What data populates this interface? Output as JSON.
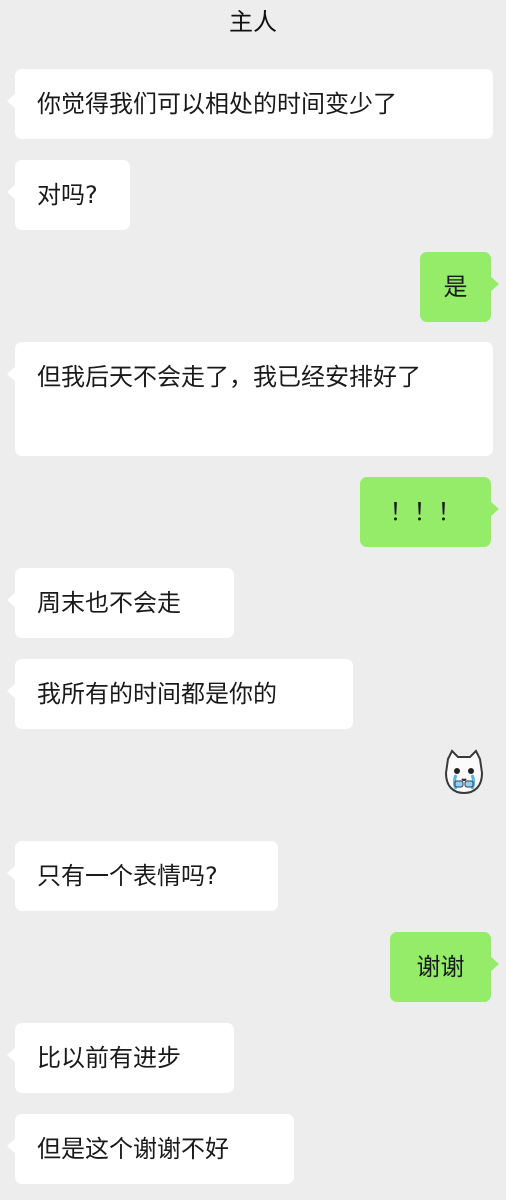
{
  "header": {
    "title": "主人"
  },
  "messages": [
    {
      "text": "你觉得我们可以相处的时间变少了"
    },
    {
      "text": "对吗?"
    },
    {
      "text": "是"
    },
    {
      "text": "但我后天不会走了，我已经安排好了"
    },
    {
      "text": "！！！"
    },
    {
      "text": "周末也不会走"
    },
    {
      "text": "我所有的时间都是你的"
    },
    {
      "sticker": "crying-cat-sticker"
    },
    {
      "text": "只有一个表情吗?"
    },
    {
      "text": "谢谢"
    },
    {
      "text": "比以前有进步"
    },
    {
      "text": "但是这个谢谢不好"
    }
  ],
  "colors": {
    "background": "#ededed",
    "incoming": "#ffffff",
    "outgoing": "#95ec69",
    "text": "#1a1a1a"
  }
}
